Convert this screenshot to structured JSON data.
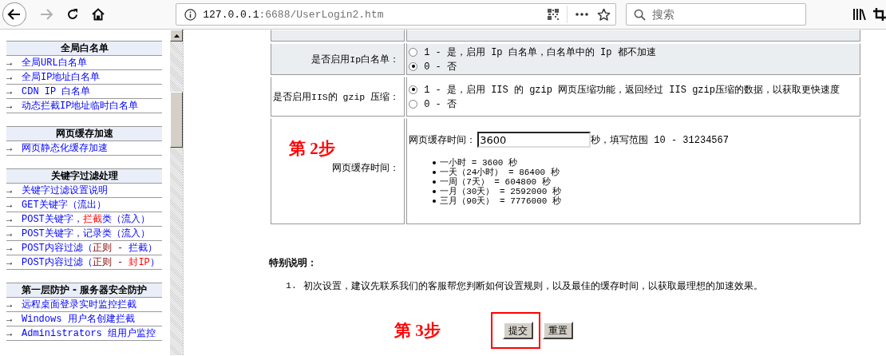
{
  "toolbar": {
    "forward_disabled": true,
    "url_host": "127.0.0.1",
    "url_rest": ":6688/UserLogin2.htm",
    "search": {
      "placeholder": "搜索"
    }
  },
  "sidebar": {
    "sections": [
      {
        "title": "全局白名单",
        "items": [
          {
            "arrow": "→",
            "parts": [
              {
                "text": "全局URL白名单"
              }
            ]
          },
          {
            "arrow": "→",
            "parts": [
              {
                "text": "全局IP地址白名单"
              }
            ]
          },
          {
            "arrow": "→",
            "parts": [
              {
                "text": "CDN IP 白名单"
              }
            ]
          },
          {
            "arrow": "→",
            "parts": [
              {
                "text": "动态拦截IP地址临时白名单"
              }
            ]
          }
        ]
      },
      {
        "title": "网页缓存加速",
        "items": [
          {
            "arrow": "→",
            "parts": [
              {
                "text": "网页静态化缓存加速"
              }
            ]
          }
        ]
      },
      {
        "title": "关键字过滤处理",
        "items": [
          {
            "arrow": "→",
            "parts": [
              {
                "text": "关键字过滤设置说明"
              }
            ]
          },
          {
            "arrow": "→",
            "parts": [
              {
                "text": "GET关键字（流出）"
              }
            ]
          },
          {
            "arrow": "→",
            "parts": [
              {
                "text": "POST关键字，"
              },
              {
                "text": "拦截",
                "kind": "alert"
              },
              {
                "text": "类（流入）"
              }
            ]
          },
          {
            "arrow": "→",
            "parts": [
              {
                "text": "POST关键字，记录类（流入）"
              }
            ]
          },
          {
            "arrow": "→",
            "parts": [
              {
                "text": "POST内容过滤（"
              },
              {
                "text": "正则 - ",
                "kind": "rule"
              },
              {
                "text": "拦截）"
              }
            ]
          },
          {
            "arrow": "→",
            "parts": [
              {
                "text": "POST内容过滤（"
              },
              {
                "text": "正则 - ",
                "kind": "rule"
              },
              {
                "text": "封IP",
                "kind": "alert"
              },
              {
                "text": "）"
              }
            ]
          }
        ]
      },
      {
        "title": "第一层防护 - 服务器安全防护",
        "items": [
          {
            "arrow": "→",
            "parts": [
              {
                "text": "远程桌面登录实时监控拦截"
              }
            ]
          },
          {
            "arrow": "→",
            "parts": [
              {
                "text": "Windows 用户名创建拦截"
              }
            ]
          },
          {
            "arrow": "→",
            "parts": [
              {
                "text": "Administrators 组用户监控"
              }
            ]
          }
        ]
      }
    ]
  },
  "form": {
    "rows": [
      {
        "kind": "blank",
        "shaded": true
      },
      {
        "kind": "radio",
        "shaded": true,
        "label": "是否启用Ip白名单：",
        "options": [
          {
            "text": "1 - 是，启用 Ip 白名单，白名单中的 Ip 都不加速",
            "selected": false
          },
          {
            "text": "0 - 否",
            "selected": true
          }
        ]
      },
      {
        "kind": "radio",
        "shaded": false,
        "label": "是否启用IIS的 gzip 压缩：",
        "options": [
          {
            "text": "1 - 是，启用 IIS 的 gzip 网页压缩功能，返回经过 IIS gzip压缩的数据，以获取更快速度",
            "selected": true
          },
          {
            "text": "0 - 否",
            "selected": false
          }
        ]
      },
      {
        "kind": "cache",
        "shaded": false,
        "step": "第 2步",
        "label": "网页缓存时间：",
        "field_label": "网页缓存时间：",
        "value": "3600",
        "hint": "秒，填写范围 10 - 31234567",
        "bullets": [
          "一小时 = 3600 秒",
          "一天（24小时） = 86400 秒",
          "一周（7天） = 604800 秒",
          "一月（30天） = 2592000 秒",
          "三月（90天） = 7776000 秒"
        ]
      }
    ]
  },
  "notes": {
    "title": "特别说明：",
    "items": [
      {
        "number": "1.",
        "text": "初次设置，建议先联系我们的客服帮您判断如何设置规则，以及最佳的缓存时间，以获取最理想的加速效果。"
      }
    ]
  },
  "actions": {
    "step": "第 3步",
    "buttons": [
      {
        "label": "提交",
        "highlighted": true
      },
      {
        "label": "重置",
        "highlighted": false
      }
    ]
  }
}
